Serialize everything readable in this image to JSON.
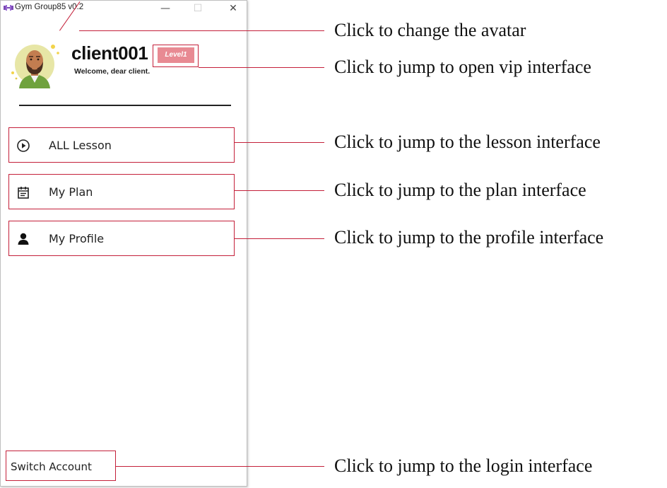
{
  "window": {
    "title": "Gym Group85 v0.2",
    "minimize_label": "—",
    "maximize_label": "☐",
    "close_label": "✕"
  },
  "profile": {
    "username": "client001",
    "level_badge": "Level1",
    "welcome": "Welcome, dear client."
  },
  "menu": {
    "items": [
      {
        "label": "ALL Lesson",
        "icon": "play-circle-icon"
      },
      {
        "label": "My Plan",
        "icon": "calendar-icon"
      },
      {
        "label": "My Profile",
        "icon": "user-icon"
      }
    ]
  },
  "footer": {
    "switch_account": "Switch Account"
  },
  "annotations": [
    "Click to change the avatar",
    "Click to jump to open vip interface",
    "Click to jump to the lesson interface",
    "Click to jump to the plan interface",
    "Click to jump to the profile interface",
    "Click to jump to the login interface"
  ],
  "colors": {
    "annotation_red": "#c4203a",
    "badge_pink": "#e88a93",
    "app_icon_purple": "#7b4ab5"
  }
}
